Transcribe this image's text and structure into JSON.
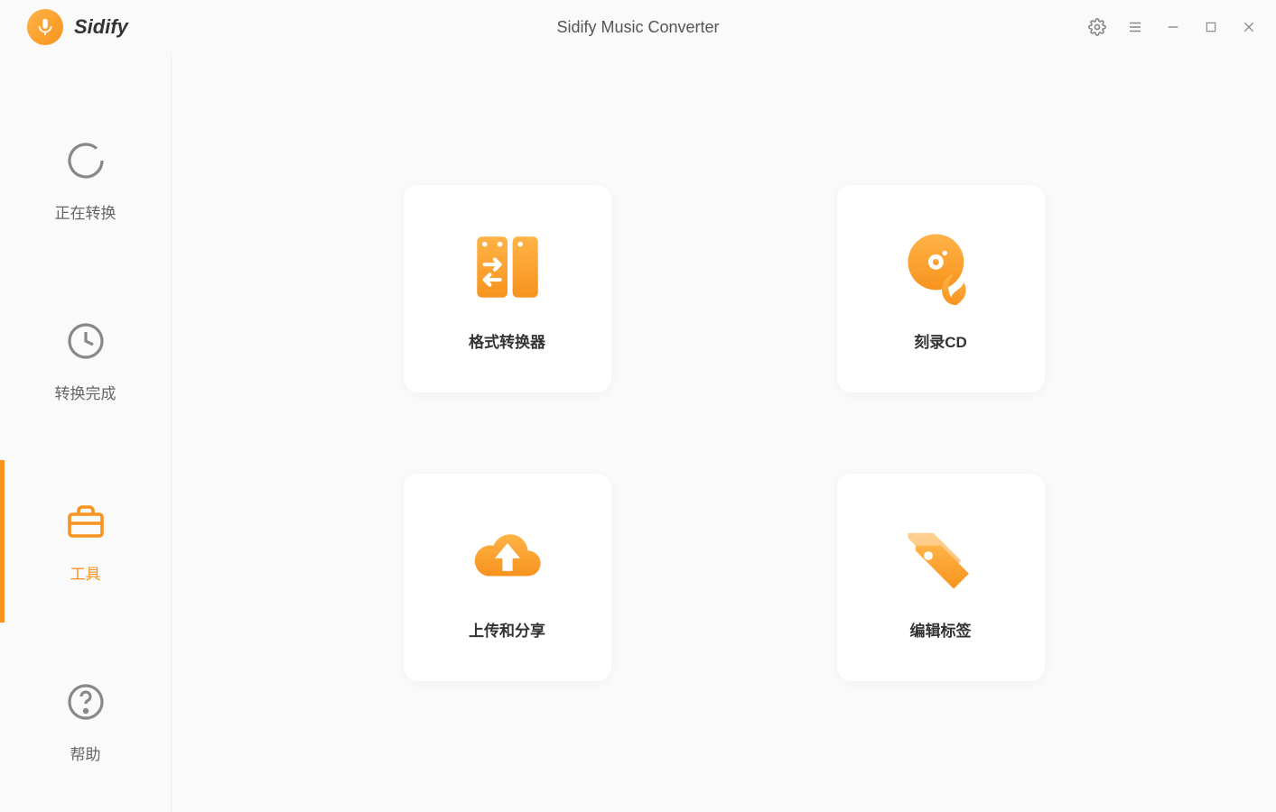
{
  "app": {
    "name": "Sidify",
    "title": "Sidify Music Converter"
  },
  "sidebar": {
    "items": [
      {
        "label": "正在转换"
      },
      {
        "label": "转换完成"
      },
      {
        "label": "工具"
      },
      {
        "label": "帮助"
      }
    ]
  },
  "tools": {
    "items": [
      {
        "label": "格式转换器"
      },
      {
        "label": "刻录CD"
      },
      {
        "label": "上传和分享"
      },
      {
        "label": "编辑标签"
      }
    ]
  },
  "colors": {
    "accent": "#f7931e"
  }
}
